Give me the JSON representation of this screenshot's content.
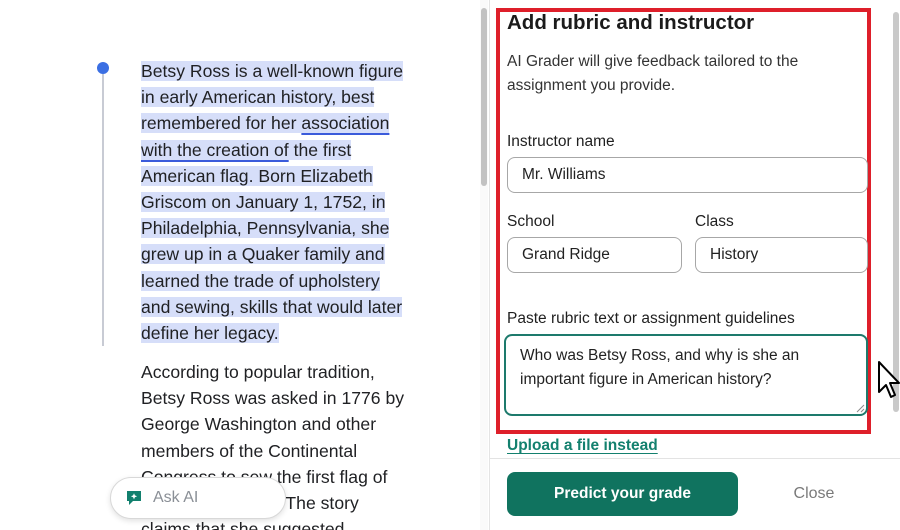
{
  "document": {
    "paragraph1_lines": [
      {
        "segments": [
          {
            "text": "Betsy Ross is a well-known figure",
            "highlight": true
          }
        ]
      },
      {
        "segments": [
          {
            "text": "in early American history, best",
            "highlight": true
          }
        ]
      },
      {
        "segments": [
          {
            "text": "remembered for her ",
            "highlight": true
          },
          {
            "text": "association",
            "highlight": true,
            "underline": true
          }
        ]
      },
      {
        "segments": [
          {
            "text": "with the creation of",
            "highlight": true,
            "underline": true
          },
          {
            "text": " the first",
            "highlight": true
          }
        ]
      },
      {
        "segments": [
          {
            "text": "American flag. Born Elizabeth",
            "highlight": true
          }
        ]
      },
      {
        "segments": [
          {
            "text": "Griscom on January 1, 1752, in",
            "highlight": true
          }
        ]
      },
      {
        "segments": [
          {
            "text": "Philadelphia, Pennsylvania, she",
            "highlight": true
          }
        ]
      },
      {
        "segments": [
          {
            "text": "grew up in a Quaker family and",
            "highlight": true
          }
        ]
      },
      {
        "segments": [
          {
            "text": "learned the trade of upholstery",
            "highlight": true
          }
        ]
      },
      {
        "segments": [
          {
            "text": "and sewing, skills that would later",
            "highlight": true
          }
        ]
      },
      {
        "segments": [
          {
            "text": "define her legacy.",
            "highlight": true
          }
        ]
      }
    ],
    "paragraph2_lines": [
      "According to popular tradition,",
      "Betsy Ross was asked in 1776 by",
      "George Washington and other",
      "members of the Continental",
      "Congress to sew the first flag of",
      "the United States. The story",
      "claims that she suggested"
    ],
    "highlight_color": "#d6def9",
    "comment_marker_color": "#3b6fe3"
  },
  "ask_ai": {
    "label": "Ask AI",
    "icon": "sparkle-chat-icon"
  },
  "panel": {
    "title": "Add rubric and instructor",
    "description": "AI Grader will give feedback tailored to the assignment you provide.",
    "instructor_label": "Instructor name",
    "instructor_value": "Mr. Williams",
    "school_label": "School",
    "school_value": "Grand Ridge",
    "class_label": "Class",
    "class_value": "History",
    "paste_label": "Paste rubric text or assignment guidelines",
    "paste_value": "Who was Betsy Ross, and why is she an important figure in American history?",
    "upload_link": "Upload a file instead",
    "predict_button": "Predict your grade",
    "close_button": "Close",
    "accent_color": "#10735f",
    "highlight_frame_color": "#de1f2a"
  }
}
